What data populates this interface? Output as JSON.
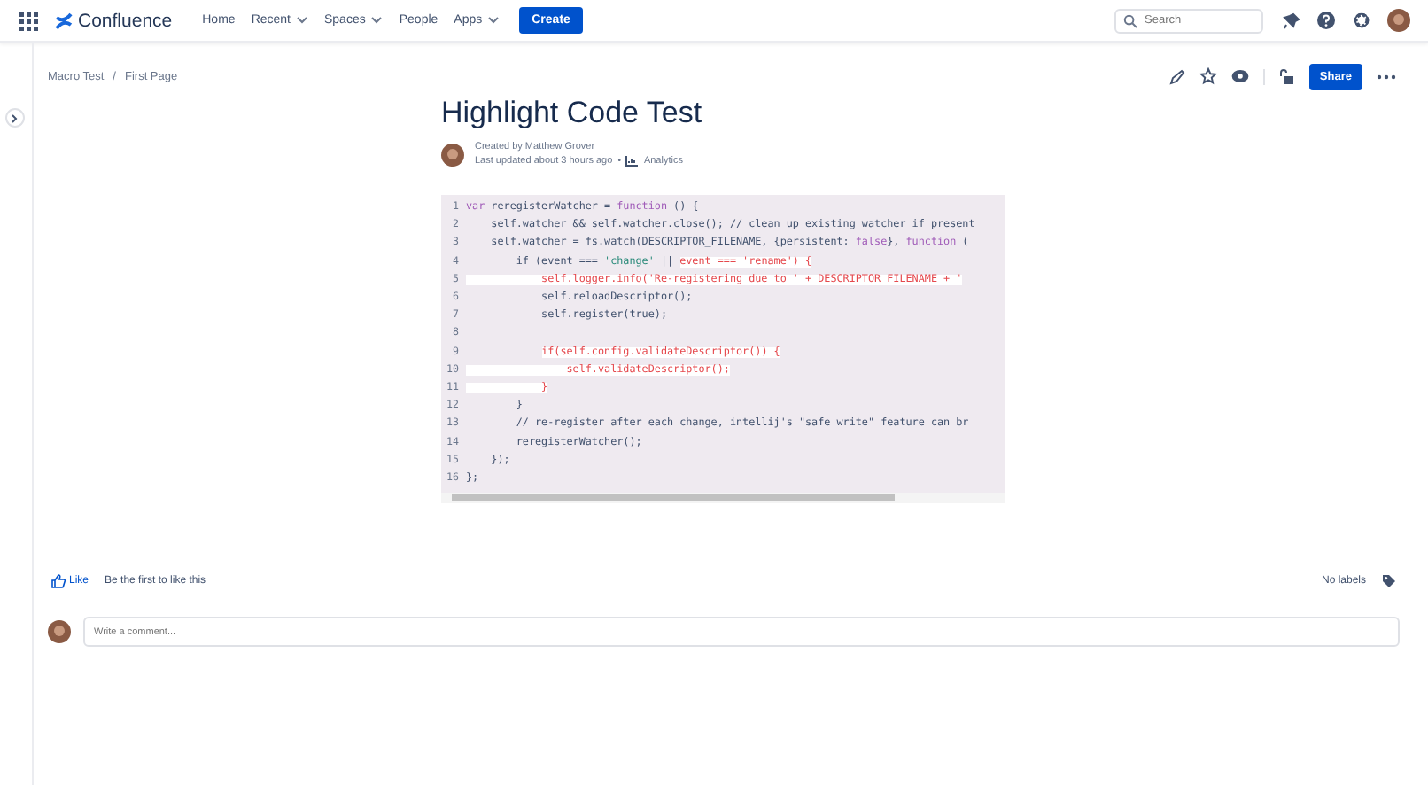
{
  "topbar": {
    "product": "Confluence",
    "nav": [
      {
        "label": "Home",
        "dropdown": false
      },
      {
        "label": "Recent",
        "dropdown": true
      },
      {
        "label": "Spaces",
        "dropdown": true
      },
      {
        "label": "People",
        "dropdown": false
      },
      {
        "label": "Apps",
        "dropdown": true
      }
    ],
    "create": "Create",
    "search": {
      "placeholder": "Search"
    }
  },
  "breadcrumbs": [
    "Macro Test",
    "First Page"
  ],
  "breadcrumb_separator": "/",
  "actions": {
    "share": "Share"
  },
  "page": {
    "title": "Highlight Code Test",
    "created_by": "Created by Matthew Grover",
    "updated": "Last updated about 3 hours ago",
    "separator": "•",
    "analytics": "Analytics"
  },
  "code": {
    "lines": [
      {
        "number": "1",
        "segments": [
          {
            "text": "var",
            "kind": "keyword"
          },
          {
            "text": " reregisterWatcher = ",
            "kind": "plain"
          },
          {
            "text": "function",
            "kind": "keyword"
          },
          {
            "text": " () {",
            "kind": "plain"
          }
        ]
      },
      {
        "number": "2",
        "segments": [
          {
            "text": "    self.watcher && self.watcher.close(); // clean up existing watcher if present",
            "kind": "plain"
          }
        ]
      },
      {
        "number": "3",
        "segments": [
          {
            "text": "    self.watcher = fs.watch(DESCRIPTOR_FILENAME, {persistent: ",
            "kind": "plain"
          },
          {
            "text": "false",
            "kind": "keyword"
          },
          {
            "text": "}, ",
            "kind": "plain"
          },
          {
            "text": "function",
            "kind": "keyword"
          },
          {
            "text": " (",
            "kind": "plain"
          }
        ]
      },
      {
        "number": "4",
        "segments": [
          {
            "text": "        if (event === ",
            "kind": "plain"
          },
          {
            "text": "'change'",
            "kind": "string"
          },
          {
            "text": " || ",
            "kind": "plain"
          },
          {
            "text": "event === 'rename') {",
            "kind": "highlight"
          }
        ]
      },
      {
        "number": "5",
        "segments": [
          {
            "text": "            self.logger.info('Re-registering due to ' + DESCRIPTOR_FILENAME + '",
            "kind": "highlight"
          }
        ]
      },
      {
        "number": "6",
        "segments": [
          {
            "text": "            self.reloadDescriptor();",
            "kind": "plain"
          }
        ]
      },
      {
        "number": "7",
        "segments": [
          {
            "text": "            self.register(true);",
            "kind": "plain"
          }
        ]
      },
      {
        "number": "8"
      },
      {
        "number": "9",
        "segments": [
          {
            "text": "            if(self.config.validateDescriptor()) {",
            "kind": "marked"
          }
        ]
      },
      {
        "number": "10",
        "segments": [
          {
            "text": "                self.validateDescriptor();",
            "kind": "highlight"
          }
        ]
      },
      {
        "number": "11",
        "segments": [
          {
            "text": "            }",
            "kind": "highlight"
          }
        ]
      },
      {
        "number": "12",
        "segments": [
          {
            "text": "        }",
            "kind": "plain"
          }
        ]
      },
      {
        "number": "13",
        "segments": [
          {
            "text": "        // re-register after each change, intellij's \"safe write\" feature can br",
            "kind": "plain"
          }
        ]
      },
      {
        "number": "14",
        "segments": [
          {
            "text": "        reregisterWatcher();",
            "kind": "plain"
          }
        ]
      },
      {
        "number": "15",
        "segments": [
          {
            "text": "    });",
            "kind": "plain"
          }
        ]
      },
      {
        "number": "16",
        "segments": [
          {
            "text": "};",
            "kind": "plain"
          }
        ]
      }
    ]
  },
  "like": {
    "label": "Like",
    "note": "Be the first to like this"
  },
  "labels": "No labels",
  "comment": {
    "placeholder": "Write a comment..."
  }
}
